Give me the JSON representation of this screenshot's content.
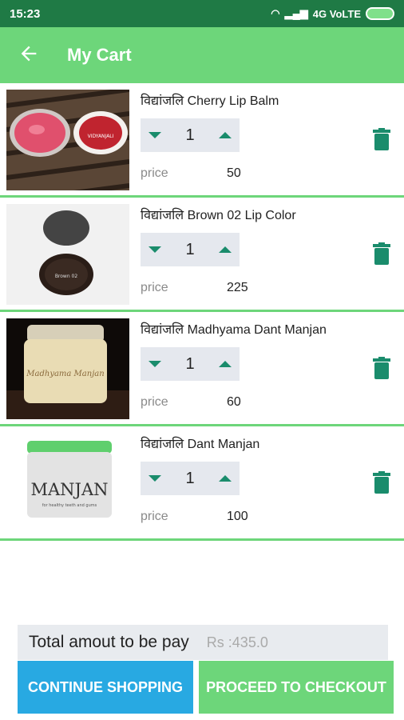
{
  "status": {
    "time": "15:23",
    "network": "4G VoLTE"
  },
  "header": {
    "title": "My Cart"
  },
  "items": [
    {
      "name": "विद्यांजलि  Cherry Lip Balm",
      "quantity": "1",
      "price_label": "price",
      "price": "50"
    },
    {
      "name": "विद्यांजलि  Brown 02 Lip Color",
      "quantity": "1",
      "price_label": "price",
      "price": "225"
    },
    {
      "name": "विद्यांजलि   Madhyama Dant Manjan",
      "quantity": "1",
      "price_label": "price",
      "price": "60"
    },
    {
      "name": "विद्यांजलि    Dant Manjan",
      "quantity": "1",
      "price_label": "price",
      "price": "100"
    }
  ],
  "product_images": {
    "item0": {
      "jar_lettering": "VIDYANJALI"
    },
    "item1": {
      "jar_lettering": "Brown 02"
    },
    "item2": {
      "jar_lettering": "Madhyama Manjan"
    },
    "item3": {
      "jar_lettering": "MANJAN",
      "jar_subtext": "for healthy teeth and gums"
    }
  },
  "footer": {
    "total_label": "Total amout to be pay",
    "total_value": "Rs :435.0",
    "continue_label": "CONTINUE SHOPPING",
    "checkout_label": "PROCEED TO CHECKOUT"
  },
  "colors": {
    "status_bar": "#1f7a45",
    "app_bar": "#6dd67a",
    "accent_icon": "#1a8c6c",
    "continue_button": "#28a9e2",
    "checkout_button": "#6dd67a"
  }
}
